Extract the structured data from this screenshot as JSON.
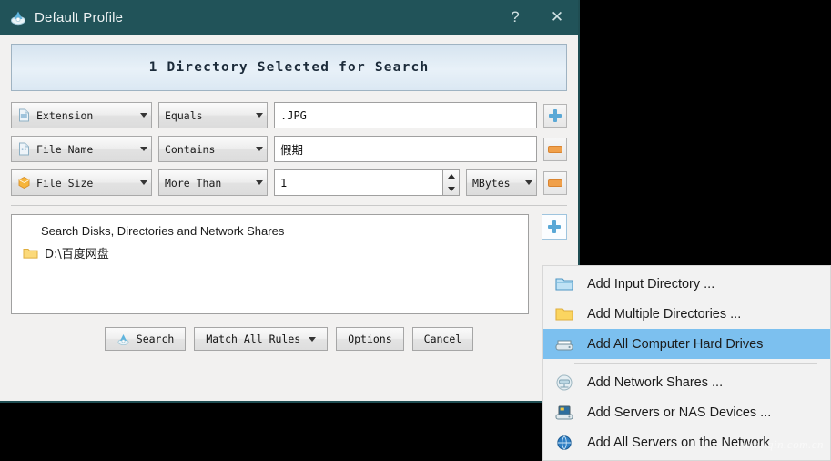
{
  "window": {
    "title": "Default Profile",
    "icon": "app-search-icon",
    "help_label": "?",
    "close_label": "✕",
    "titlebar_color": "#215359"
  },
  "banner": {
    "text": "1 Directory Selected for Search"
  },
  "filters": [
    {
      "icon": "extension-file-icon",
      "type": "Extension",
      "operator": "Equals",
      "value": ".JPG",
      "action_icon": "plus-icon",
      "action": "add-rule"
    },
    {
      "icon": "filename-file-icon",
      "type": "File Name",
      "operator": "Contains",
      "value": "假期",
      "action_icon": "minus-icon",
      "action": "remove-rule"
    },
    {
      "icon": "filesize-box-icon",
      "type": "File Size",
      "operator": "More Than",
      "value": "1",
      "unit": "MBytes",
      "action_icon": "minus-icon",
      "action": "remove-rule"
    }
  ],
  "directory_list": {
    "header": "Search Disks, Directories and Network Shares",
    "items": [
      {
        "icon": "folder-icon",
        "path": "D:\\百度网盘"
      }
    ],
    "add_button_icon": "plus-icon"
  },
  "buttons": {
    "search": "Search",
    "search_icon": "search-icon",
    "match_rules": "Match All Rules",
    "options": "Options",
    "cancel": "Cancel"
  },
  "context_menu": {
    "items": [
      {
        "icon": "blue-folder-icon",
        "label": "Add Input Directory ...",
        "selected": false,
        "separator_after": false
      },
      {
        "icon": "yellow-folder-icon",
        "label": "Add Multiple Directories ...",
        "selected": false,
        "separator_after": false
      },
      {
        "icon": "harddrive-icon",
        "label": "Add All Computer Hard Drives",
        "selected": true,
        "separator_after": true
      },
      {
        "icon": "network-share-icon",
        "label": "Add Network Shares ...",
        "selected": false,
        "separator_after": false
      },
      {
        "icon": "server-nas-icon",
        "label": "Add Servers or NAS Devices ...",
        "selected": false,
        "separator_after": false
      },
      {
        "icon": "globe-icon",
        "label": "Add All Servers on the Network",
        "selected": false,
        "separator_after": false
      }
    ],
    "highlight_color": "#7cc0ef"
  },
  "watermark": {
    "text": "www.xqin.com.cn"
  }
}
